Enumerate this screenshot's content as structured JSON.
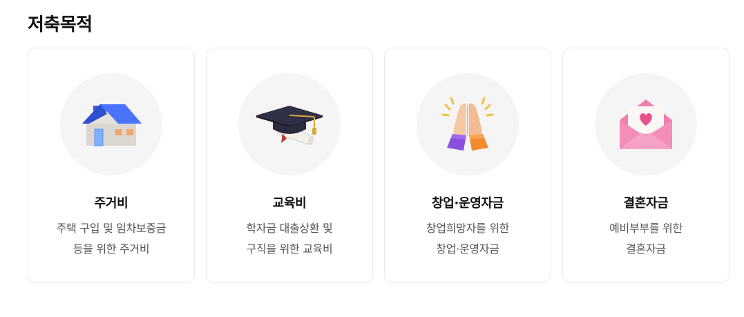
{
  "section": {
    "title": "저축목적"
  },
  "cards": [
    {
      "icon": "house-icon",
      "title": "주거비",
      "desc_line1": "주택 구입 및 임차보증금",
      "desc_line2": "등을 위한 주거비"
    },
    {
      "icon": "graduation-cap-icon",
      "title": "교육비",
      "desc_line1": "학자금 대출상환 및",
      "desc_line2": "구직을 위한 교육비"
    },
    {
      "icon": "high-five-hands-icon",
      "title": "창업·운영자금",
      "desc_line1": "창업희망자를 위한",
      "desc_line2": "창업·운영자금"
    },
    {
      "icon": "love-letter-icon",
      "title": "결혼자금",
      "desc_line1": "예비부부를 위한",
      "desc_line2": "결혼자금"
    }
  ],
  "colors": {
    "card_border": "#e9e9e9",
    "icon_bg": "#f5f5f5",
    "title_text": "#111111",
    "desc_text": "#555555"
  }
}
